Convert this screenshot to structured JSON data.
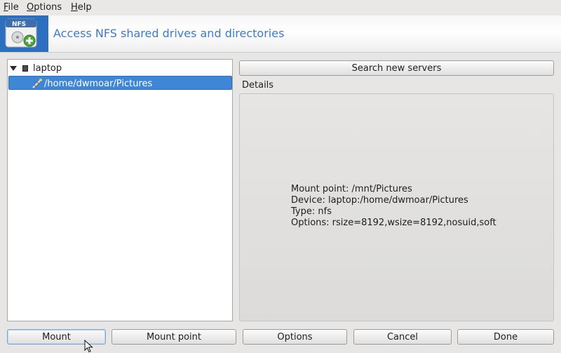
{
  "menu": {
    "file": {
      "mnemonic": "F",
      "rest": "ile"
    },
    "options": {
      "mnemonic": "O",
      "rest": "ptions"
    },
    "help": {
      "mnemonic": "H",
      "rest": "elp"
    }
  },
  "banner": {
    "icon_text": "NFS",
    "title": "Access NFS shared drives and directories"
  },
  "tree": {
    "host": {
      "label": "laptop",
      "expanded": true
    },
    "shares": [
      {
        "label": "/home/dwmoar/Pictures",
        "selected": true
      }
    ]
  },
  "search_button": "Search new servers",
  "details": {
    "label": "Details",
    "mount_point": "Mount point: /mnt/Pictures",
    "device": "Device: laptop:/home/dwmoar/Pictures",
    "type": "Type: nfs",
    "options": "Options: rsize=8192,wsize=8192,nosuid,soft"
  },
  "buttons": {
    "mount": "Mount",
    "mount_point": "Mount point",
    "options": "Options",
    "cancel": "Cancel",
    "done": "Done"
  },
  "colors": {
    "selection": "#3f87d6",
    "banner_title": "#3a7bd0",
    "banner_icon_bg": "#2d6fbf"
  }
}
